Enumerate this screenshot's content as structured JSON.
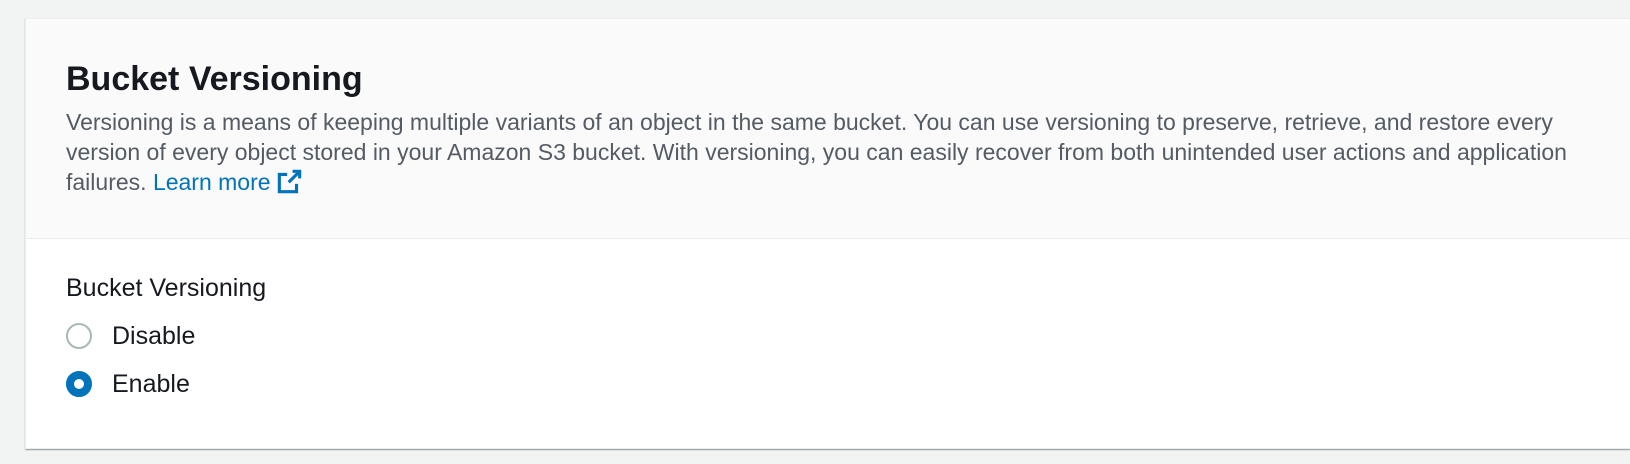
{
  "header": {
    "title": "Bucket Versioning",
    "description": "Versioning is a means of keeping multiple variants of an object in the same bucket. You can use versioning to preserve, retrieve, and restore every version of every object stored in your Amazon S3 bucket. With versioning, you can easily recover from both unintended user actions and application failures.",
    "learn_more": "Learn more",
    "learn_more_icon": "external-link-icon"
  },
  "form": {
    "label": "Bucket Versioning",
    "options": [
      {
        "label": "Disable",
        "selected": false
      },
      {
        "label": "Enable",
        "selected": true
      }
    ]
  },
  "colors": {
    "accent": "#0073bb",
    "header_background": "#fafafa",
    "page_background": "#f2f3f3",
    "description_text": "#545b64"
  }
}
